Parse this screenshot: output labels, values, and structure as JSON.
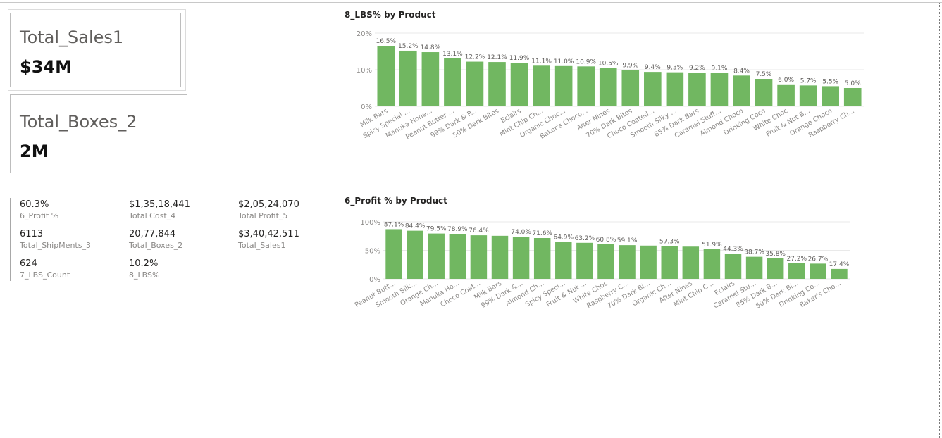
{
  "cards": [
    {
      "label": "Total_Sales1",
      "value": "$34M"
    },
    {
      "label": "Total_Boxes_2",
      "value": "2M"
    }
  ],
  "multirow": [
    {
      "value": "60.3%",
      "label": "6_Profit %"
    },
    {
      "value": "$1,35,18,441",
      "label": "Total Cost_4"
    },
    {
      "value": "$2,05,24,070",
      "label": "Total Profit_5"
    },
    {
      "value": "6113",
      "label": "Total_ShipMents_3"
    },
    {
      "value": "20,77,844",
      "label": "Total_Boxes_2"
    },
    {
      "value": "$3,40,42,511",
      "label": "Total_Sales1"
    },
    {
      "value": "624",
      "label": "7_LBS_Count"
    },
    {
      "value": "10.2%",
      "label": "8_LBS%"
    }
  ],
  "colors": {
    "bar": "#71b761",
    "grid": "#e9e9e9",
    "axis_text": "#8a8886",
    "data_label": "#605e5c"
  },
  "chart_data": [
    {
      "type": "bar",
      "title": "8_LBS% by Product",
      "xlabel": "",
      "ylabel": "",
      "ylim": [
        0,
        20
      ],
      "yticks": [
        0,
        10,
        20
      ],
      "ytick_labels": [
        "0%",
        "10%",
        "20%"
      ],
      "grid": true,
      "categories": [
        "Milk Bars",
        "Spicy Special ...",
        "Manuka Hone...",
        "Peanut Butter ...",
        "99% Dark & P...",
        "50% Dark Bites",
        "Eclairs",
        "Mint Chip Ch...",
        "Organic Choc...",
        "Baker's Choco...",
        "After Nines",
        "70% Dark Bites",
        "Choco Coated...",
        "Smooth Silky ...",
        "85% Dark Bars",
        "Caramel Stuff...",
        "Almond Choco",
        "Drinking Coco",
        "White Choc",
        "Fruit & Nut B...",
        "Orange Choco",
        "Raspberry Ch..."
      ],
      "values": [
        16.5,
        15.2,
        14.8,
        13.1,
        12.2,
        12.1,
        11.9,
        11.1,
        11.0,
        10.9,
        10.5,
        9.9,
        9.4,
        9.3,
        9.2,
        9.1,
        8.4,
        7.5,
        6.0,
        5.7,
        5.5,
        5.0
      ],
      "data_labels": [
        "16.5%",
        "15.2%",
        "14.8%",
        "13.1%",
        "12.2%",
        "12.1%",
        "11.9%",
        "11.1%",
        "11.0%",
        "10.9%",
        "10.5%",
        "9.9%",
        "9.4%",
        "9.3%",
        "9.2%",
        "9.1%",
        "8.4%",
        "7.5%",
        "6.0%",
        "5.7%",
        "5.5%",
        "5.0%"
      ]
    },
    {
      "type": "bar",
      "title": "6_Profit % by Product",
      "xlabel": "",
      "ylabel": "",
      "ylim": [
        0,
        100
      ],
      "yticks": [
        0,
        50,
        100
      ],
      "ytick_labels": [
        "0%",
        "50%",
        "100%"
      ],
      "grid": true,
      "categories": [
        "Peanut Butt...",
        "Smooth Silk...",
        "Orange Ch...",
        "Manuka Ho...",
        "Choco Coat...",
        "Milk Bars",
        "99% Dark &...",
        "Almond Ch...",
        "Spicy Speci...",
        "Fruit & Nut ...",
        "White Choc",
        "Raspberry C...",
        "70% Dark Bi...",
        "Organic Ch...",
        "After Nines",
        "Mint Chip C...",
        "Eclairs",
        "Caramel Stu...",
        "85% Dark B...",
        "50% Dark Bi...",
        "Drinking Co...",
        "Baker's Cho..."
      ],
      "values": [
        87.1,
        84.4,
        79.5,
        78.9,
        76.4,
        75.5,
        74.0,
        71.6,
        64.9,
        63.2,
        60.8,
        59.1,
        58.3,
        57.3,
        56.5,
        51.9,
        44.3,
        38.7,
        35.8,
        27.2,
        26.7,
        17.4
      ],
      "data_labels": [
        "87.1%",
        "84.4%",
        "79.5%",
        "78.9%",
        "76.4%",
        "",
        "74.0%",
        "71.6%",
        "64.9%",
        "63.2%",
        "60.8%",
        "59.1%",
        "",
        "57.3%",
        "",
        "51.9%",
        "44.3%",
        "38.7%",
        "35.8%",
        "27.2%",
        "26.7%",
        "17.4%"
      ]
    }
  ]
}
